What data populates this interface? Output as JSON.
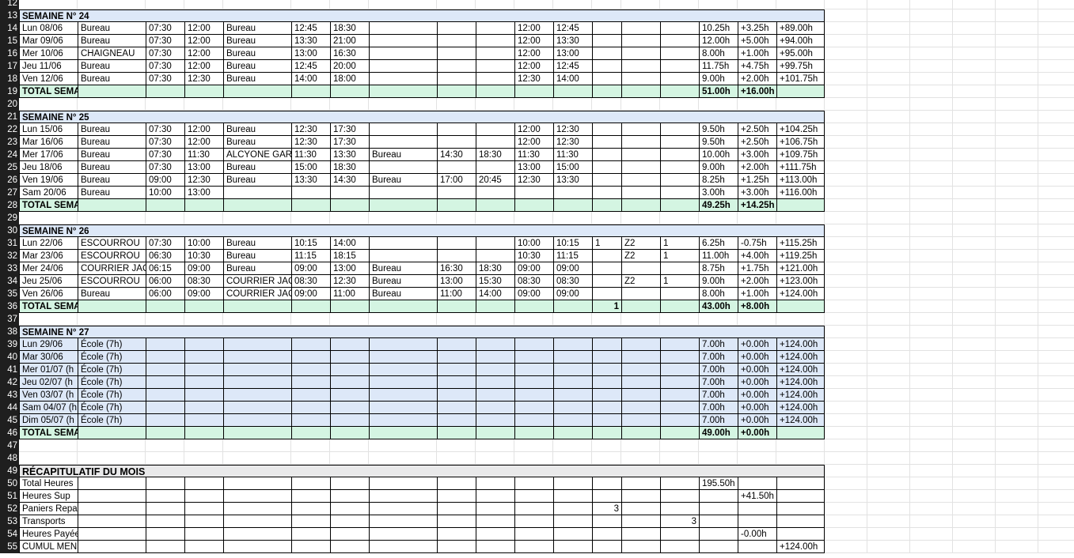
{
  "sheet": {
    "rows": [
      {
        "n": "12",
        "type": "blank"
      },
      {
        "n": "13",
        "type": "week_header",
        "label": "SEMAINE N° 24"
      },
      {
        "n": "14",
        "type": "data",
        "cells": [
          "Lun 08/06",
          "Bureau",
          "07:30",
          "12:00",
          "Bureau",
          "12:45",
          "18:30",
          "",
          "",
          "",
          "12:00",
          "12:45",
          "",
          "",
          "",
          "10.25h",
          "+3.25h",
          "+89.00h"
        ]
      },
      {
        "n": "15",
        "type": "data",
        "cells": [
          "Mar 09/06",
          "Bureau",
          "07:30",
          "12:00",
          "Bureau",
          "13:30",
          "21:00",
          "",
          "",
          "",
          "12:00",
          "13:30",
          "",
          "",
          "",
          "12.00h",
          "+5.00h",
          "+94.00h"
        ]
      },
      {
        "n": "16",
        "type": "data",
        "cells": [
          "Mer 10/06",
          "CHAIGNEAU",
          "07:30",
          "12:00",
          "Bureau",
          "13:00",
          "16:30",
          "",
          "",
          "",
          "12:00",
          "13:00",
          "",
          "",
          "",
          "8.00h",
          "+1.00h",
          "+95.00h"
        ]
      },
      {
        "n": "17",
        "type": "data",
        "cells": [
          "Jeu 11/06",
          "Bureau",
          "07:30",
          "12:00",
          "Bureau",
          "12:45",
          "20:00",
          "",
          "",
          "",
          "12:00",
          "12:45",
          "",
          "",
          "",
          "11.75h",
          "+4.75h",
          "+99.75h"
        ]
      },
      {
        "n": "18",
        "type": "data",
        "cells": [
          "Ven 12/06",
          "Bureau",
          "07:30",
          "12:30",
          "Bureau",
          "14:00",
          "18:00",
          "",
          "",
          "",
          "12:30",
          "14:00",
          "",
          "",
          "",
          "9.00h",
          "+2.00h",
          "+101.75h"
        ]
      },
      {
        "n": "19",
        "type": "total",
        "cells": [
          "TOTAL SEMA",
          "",
          "",
          "",
          "",
          "",
          "",
          "",
          "",
          "",
          "",
          "",
          "",
          "",
          "",
          "51.00h",
          "+16.00h",
          ""
        ]
      },
      {
        "n": "20",
        "type": "blank"
      },
      {
        "n": "21",
        "type": "week_header",
        "label": "SEMAINE N° 25"
      },
      {
        "n": "22",
        "type": "data",
        "cells": [
          "Lun 15/06",
          "Bureau",
          "07:30",
          "12:00",
          "Bureau",
          "12:30",
          "17:30",
          "",
          "",
          "",
          "12:00",
          "12:30",
          "",
          "",
          "",
          "9.50h",
          "+2.50h",
          "+104.25h"
        ]
      },
      {
        "n": "23",
        "type": "data",
        "cells": [
          "Mar 16/06",
          "Bureau",
          "07:30",
          "12:00",
          "Bureau",
          "12:30",
          "17:30",
          "",
          "",
          "",
          "12:00",
          "12:30",
          "",
          "",
          "",
          "9.50h",
          "+2.50h",
          "+106.75h"
        ]
      },
      {
        "n": "24",
        "type": "data",
        "cells": [
          "Mer 17/06",
          "Bureau",
          "07:30",
          "11:30",
          "ALCYONE GARAG",
          "11:30",
          "13:30",
          "Bureau",
          "14:30",
          "18:30",
          "11:30",
          "11:30",
          "",
          "",
          "",
          "10.00h",
          "+3.00h",
          "+109.75h"
        ]
      },
      {
        "n": "25",
        "type": "data",
        "cells": [
          "Jeu 18/06",
          "Bureau",
          "07:30",
          "13:00",
          "Bureau",
          "15:00",
          "18:30",
          "",
          "",
          "",
          "13:00",
          "15:00",
          "",
          "",
          "",
          "9.00h",
          "+2.00h",
          "+111.75h"
        ]
      },
      {
        "n": "26",
        "type": "data",
        "cells": [
          "Ven 19/06",
          "Bureau",
          "09:00",
          "12:30",
          "Bureau",
          "13:30",
          "14:30",
          "Bureau",
          "17:00",
          "20:45",
          "12:30",
          "13:30",
          "",
          "",
          "",
          "8.25h",
          "+1.25h",
          "+113.00h"
        ]
      },
      {
        "n": "27",
        "type": "data",
        "cells": [
          "Sam 20/06",
          "Bureau",
          "10:00",
          "13:00",
          "",
          "",
          "",
          "",
          "",
          "",
          "",
          "",
          "",
          "",
          "",
          "3.00h",
          "+3.00h",
          "+116.00h"
        ]
      },
      {
        "n": "28",
        "type": "total",
        "cells": [
          "TOTAL SEMA",
          "",
          "",
          "",
          "",
          "",
          "",
          "",
          "",
          "",
          "",
          "",
          "",
          "",
          "",
          "49.25h",
          "+14.25h",
          ""
        ]
      },
      {
        "n": "29",
        "type": "blank"
      },
      {
        "n": "30",
        "type": "week_header",
        "label": "SEMAINE N° 26"
      },
      {
        "n": "31",
        "type": "data",
        "cells": [
          "Lun 22/06",
          "ESCOURROU",
          "07:30",
          "10:00",
          "Bureau",
          "10:15",
          "14:00",
          "",
          "",
          "",
          "10:00",
          "10:15",
          "1",
          "Z2",
          "1",
          "6.25h",
          "-0.75h",
          "+115.25h"
        ]
      },
      {
        "n": "32",
        "type": "data",
        "cells": [
          "Mar 23/06",
          "ESCOURROU",
          "06:30",
          "10:30",
          "Bureau",
          "11:15",
          "18:15",
          "",
          "",
          "",
          "10:30",
          "11:15",
          "",
          "Z2",
          "1",
          "11.00h",
          "+4.00h",
          "+119.25h"
        ]
      },
      {
        "n": "33",
        "type": "data",
        "cells": [
          "Mer 24/06",
          "COURRIER JACQ",
          "06:15",
          "09:00",
          "Bureau",
          "09:00",
          "13:00",
          "Bureau",
          "16:30",
          "18:30",
          "09:00",
          "09:00",
          "",
          "",
          "",
          "8.75h",
          "+1.75h",
          "+121.00h"
        ]
      },
      {
        "n": "34",
        "type": "data",
        "cells": [
          "Jeu 25/06",
          "ESCOURROU",
          "06:00",
          "08:30",
          "COURRIER JACQ",
          "08:30",
          "12:30",
          "Bureau",
          "13:00",
          "15:30",
          "08:30",
          "08:30",
          "",
          "Z2",
          "1",
          "9.00h",
          "+2.00h",
          "+123.00h"
        ]
      },
      {
        "n": "35",
        "type": "data",
        "cells": [
          "Ven 26/06",
          "Bureau",
          "06:00",
          "09:00",
          "COURRIER JACQ",
          "09:00",
          "11:00",
          "Bureau",
          "11:00",
          "14:00",
          "09:00",
          "09:00",
          "",
          "",
          "",
          "8.00h",
          "+1.00h",
          "+124.00h"
        ]
      },
      {
        "n": "36",
        "type": "total",
        "cells": [
          "TOTAL SEMA",
          "",
          "",
          "",
          "",
          "",
          "",
          "",
          "",
          "",
          "",
          "",
          "1",
          "",
          "",
          "43.00h",
          "+8.00h",
          ""
        ]
      },
      {
        "n": "37",
        "type": "blank"
      },
      {
        "n": "38",
        "type": "week_header",
        "label": "SEMAINE N° 27"
      },
      {
        "n": "39",
        "type": "school",
        "cells": [
          "Lun 29/06",
          "École (7h)",
          "",
          "",
          "",
          "",
          "",
          "",
          "",
          "",
          "",
          "",
          "",
          "",
          "",
          "7.00h",
          "+0.00h",
          "+124.00h"
        ]
      },
      {
        "n": "40",
        "type": "school",
        "cells": [
          "Mar 30/06",
          "École (7h)",
          "",
          "",
          "",
          "",
          "",
          "",
          "",
          "",
          "",
          "",
          "",
          "",
          "",
          "7.00h",
          "+0.00h",
          "+124.00h"
        ]
      },
      {
        "n": "41",
        "type": "school",
        "cells": [
          "Mer 01/07 (h",
          "École (7h)",
          "",
          "",
          "",
          "",
          "",
          "",
          "",
          "",
          "",
          "",
          "",
          "",
          "",
          "7.00h",
          "+0.00h",
          "+124.00h"
        ]
      },
      {
        "n": "42",
        "type": "school",
        "cells": [
          "Jeu 02/07 (h",
          "École (7h)",
          "",
          "",
          "",
          "",
          "",
          "",
          "",
          "",
          "",
          "",
          "",
          "",
          "",
          "7.00h",
          "+0.00h",
          "+124.00h"
        ]
      },
      {
        "n": "43",
        "type": "school",
        "cells": [
          "Ven 03/07 (h",
          "École (7h)",
          "",
          "",
          "",
          "",
          "",
          "",
          "",
          "",
          "",
          "",
          "",
          "",
          "",
          "7.00h",
          "+0.00h",
          "+124.00h"
        ]
      },
      {
        "n": "44",
        "type": "school",
        "cells": [
          "Sam 04/07 (h",
          "École (7h)",
          "",
          "",
          "",
          "",
          "",
          "",
          "",
          "",
          "",
          "",
          "",
          "",
          "",
          "7.00h",
          "+0.00h",
          "+124.00h"
        ]
      },
      {
        "n": "45",
        "type": "school",
        "cells": [
          "Dim 05/07 (h",
          "École (7h)",
          "",
          "",
          "",
          "",
          "",
          "",
          "",
          "",
          "",
          "",
          "",
          "",
          "",
          "7.00h",
          "+0.00h",
          "+124.00h"
        ]
      },
      {
        "n": "46",
        "type": "total",
        "cells": [
          "TOTAL SEMA",
          "",
          "",
          "",
          "",
          "",
          "",
          "",
          "",
          "",
          "",
          "",
          "",
          "",
          "",
          "49.00h",
          "+0.00h",
          ""
        ]
      },
      {
        "n": "47",
        "type": "blank"
      },
      {
        "n": "48",
        "type": "blank"
      },
      {
        "n": "49",
        "type": "recap_header",
        "label": "RÉCAPITULATIF DU MOIS"
      },
      {
        "n": "50",
        "type": "recap",
        "cells": [
          "Total Heures",
          "",
          "",
          "",
          "",
          "",
          "",
          "",
          "",
          "",
          "",
          "",
          "",
          "",
          "",
          "195.50h",
          "",
          ""
        ]
      },
      {
        "n": "51",
        "type": "recap",
        "cells": [
          "Heures Sup",
          "",
          "",
          "",
          "",
          "",
          "",
          "",
          "",
          "",
          "",
          "",
          "",
          "",
          "",
          "",
          "+41.50h",
          ""
        ]
      },
      {
        "n": "52",
        "type": "recap",
        "cells": [
          "Paniers Repa",
          "",
          "",
          "",
          "",
          "",
          "",
          "",
          "",
          "",
          "",
          "",
          "3",
          "",
          "",
          "",
          "",
          ""
        ]
      },
      {
        "n": "53",
        "type": "recap",
        "cells": [
          "Transports",
          "",
          "",
          "",
          "",
          "",
          "",
          "",
          "",
          "",
          "",
          "",
          "",
          "",
          "3",
          "",
          "",
          ""
        ]
      },
      {
        "n": "54",
        "type": "recap",
        "cells": [
          "Heures Payée",
          "",
          "",
          "",
          "",
          "",
          "",
          "",
          "",
          "",
          "",
          "",
          "",
          "",
          "",
          "",
          "-0.00h",
          ""
        ]
      },
      {
        "n": "55",
        "type": "recap",
        "cells": [
          "CUMUL MENS",
          "",
          "",
          "",
          "",
          "",
          "",
          "",
          "",
          "",
          "",
          "",
          "",
          "",
          "",
          "",
          "",
          "+124.00h"
        ]
      }
    ]
  },
  "colors": {
    "header_bg": "#dde8f8",
    "total_bg": "#d4f5e2",
    "recap_bg": "#e9e9ea",
    "row_header_bg": "#1f1f1f"
  }
}
